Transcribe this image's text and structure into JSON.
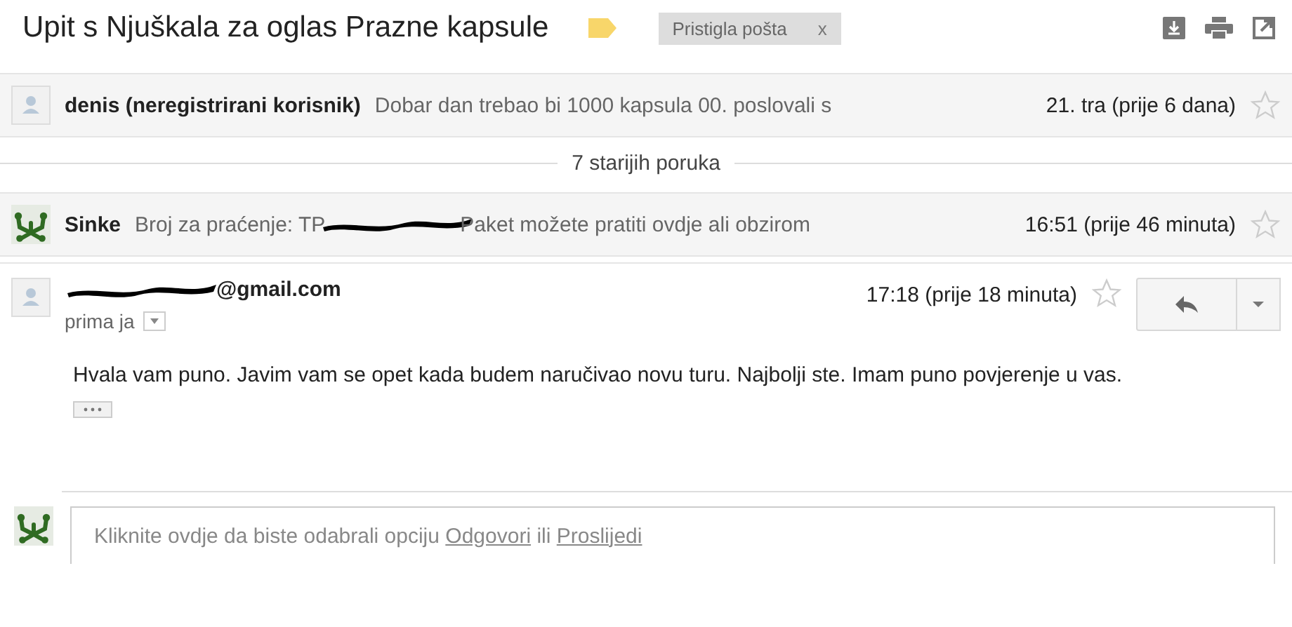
{
  "subject": "Upit s Njuškala za oglas Prazne kapsule",
  "label": {
    "text": "Pristigla pošta",
    "close": "x"
  },
  "thread": [
    {
      "kind": "collapsed",
      "avatar": {
        "kind": "person"
      },
      "sender": "denis (neregistrirani korisnik)",
      "snippet": "Dobar dan trebao bi 1000 kapsula 00. poslovali s",
      "redacted": false,
      "time": "21. tra (prije 6 dana)",
      "starred": false
    },
    {
      "kind": "older",
      "text": "7 starijih poruka"
    },
    {
      "kind": "collapsed",
      "avatar": {
        "kind": "frog"
      },
      "sender": "Sinke",
      "snippet": "Broj za praćenje: TP",
      "redacted": true,
      "snippet_after": "Paket možete pratiti ovdje ali obzirom",
      "time": "16:51 (prije 46 minuta)",
      "starred": false
    },
    {
      "kind": "expanded",
      "avatar": {
        "kind": "person"
      },
      "sender": "@gmail.com",
      "redacted": true,
      "time": "17:18 (prije 18 minuta)",
      "starred": false,
      "recipients": "prima ja",
      "body": "Hvala vam puno. Javim vam se opet kada budem naručivao novu turu. Najbolji ste. Imam puno povjerenje u vas."
    }
  ],
  "reply": {
    "avatar": {
      "kind": "frog"
    },
    "prompt": "Kliknite ovdje da biste odabrali opciju",
    "link_reply": "Odgovori",
    "joiner": "ili",
    "link_forward": "Proslijedi"
  }
}
